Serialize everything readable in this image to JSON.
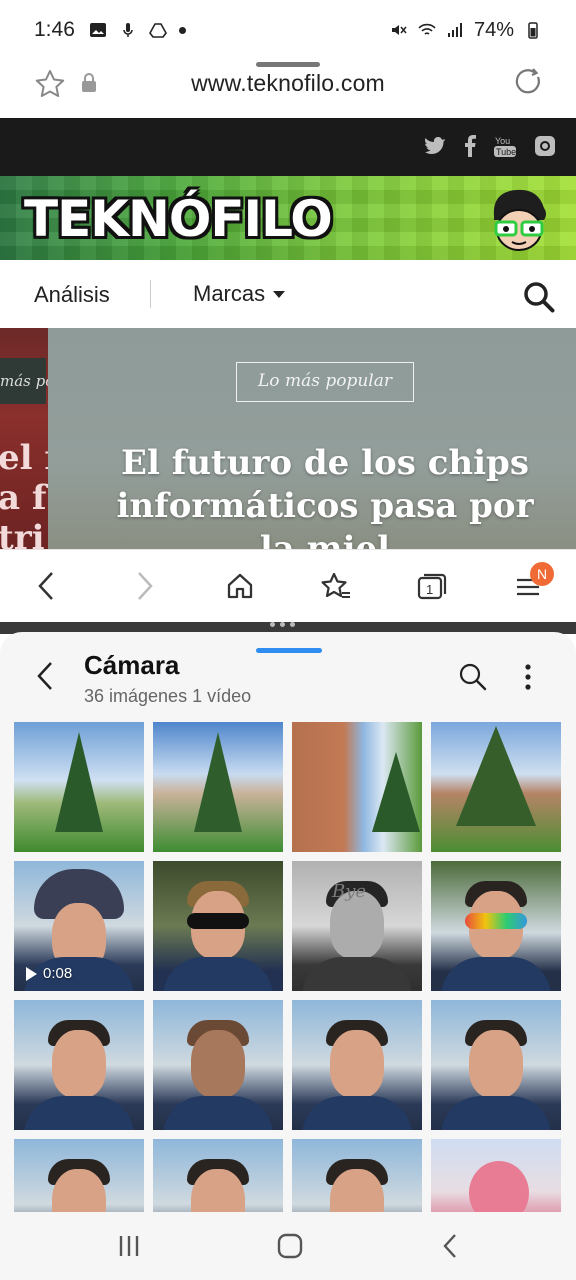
{
  "status_bar": {
    "time": "1:46",
    "battery": "74%",
    "left_icons": [
      "image-icon",
      "mic-icon",
      "drive-icon",
      "dot-icon"
    ],
    "right_icons": [
      "mute-icon",
      "wifi-icon",
      "signal-icon",
      "battery-icon"
    ]
  },
  "browser": {
    "url": "www.teknofilo.com",
    "toolbar": {
      "buttons": [
        "back-icon",
        "forward-icon",
        "home-icon",
        "bookmarks-icon",
        "tabs-icon",
        "menu-icon"
      ],
      "tab_count": "1",
      "menu_badge": "N"
    }
  },
  "site": {
    "social": [
      "twitter-icon",
      "facebook-icon",
      "youtube-icon",
      "instagram-icon"
    ],
    "logo_text": "TEKNÓFILO",
    "nav": {
      "item1": "Análisis",
      "item2": "Marcas"
    },
    "hero": {
      "tag": "Lo más popular",
      "title": "El futuro de los chips informáticos pasa por la miel",
      "left_tag": "más pop",
      "left_text": "el f\na f\ntri"
    }
  },
  "gallery": {
    "title": "Cámara",
    "subtitle": "36 imágenes 1 vídeo",
    "video_duration": "0:08",
    "sticker_text": "Bye",
    "thumbnails": [
      {
        "kind": "landscape-tree"
      },
      {
        "kind": "landscape-tree"
      },
      {
        "kind": "building"
      },
      {
        "kind": "landscape-tree"
      },
      {
        "kind": "video-portrait"
      },
      {
        "kind": "portrait-sunglasses"
      },
      {
        "kind": "portrait-bw"
      },
      {
        "kind": "portrait-heart-glasses"
      },
      {
        "kind": "portrait"
      },
      {
        "kind": "portrait-dog-filter"
      },
      {
        "kind": "portrait"
      },
      {
        "kind": "portrait"
      },
      {
        "kind": "portrait"
      },
      {
        "kind": "portrait"
      },
      {
        "kind": "portrait"
      },
      {
        "kind": "flower"
      }
    ]
  },
  "nav_bar": {
    "buttons": [
      "recents-icon",
      "home-icon",
      "back-icon"
    ]
  },
  "colors": {
    "accent_blue": "#2f8cf0",
    "badge_orange": "#f06a35"
  }
}
